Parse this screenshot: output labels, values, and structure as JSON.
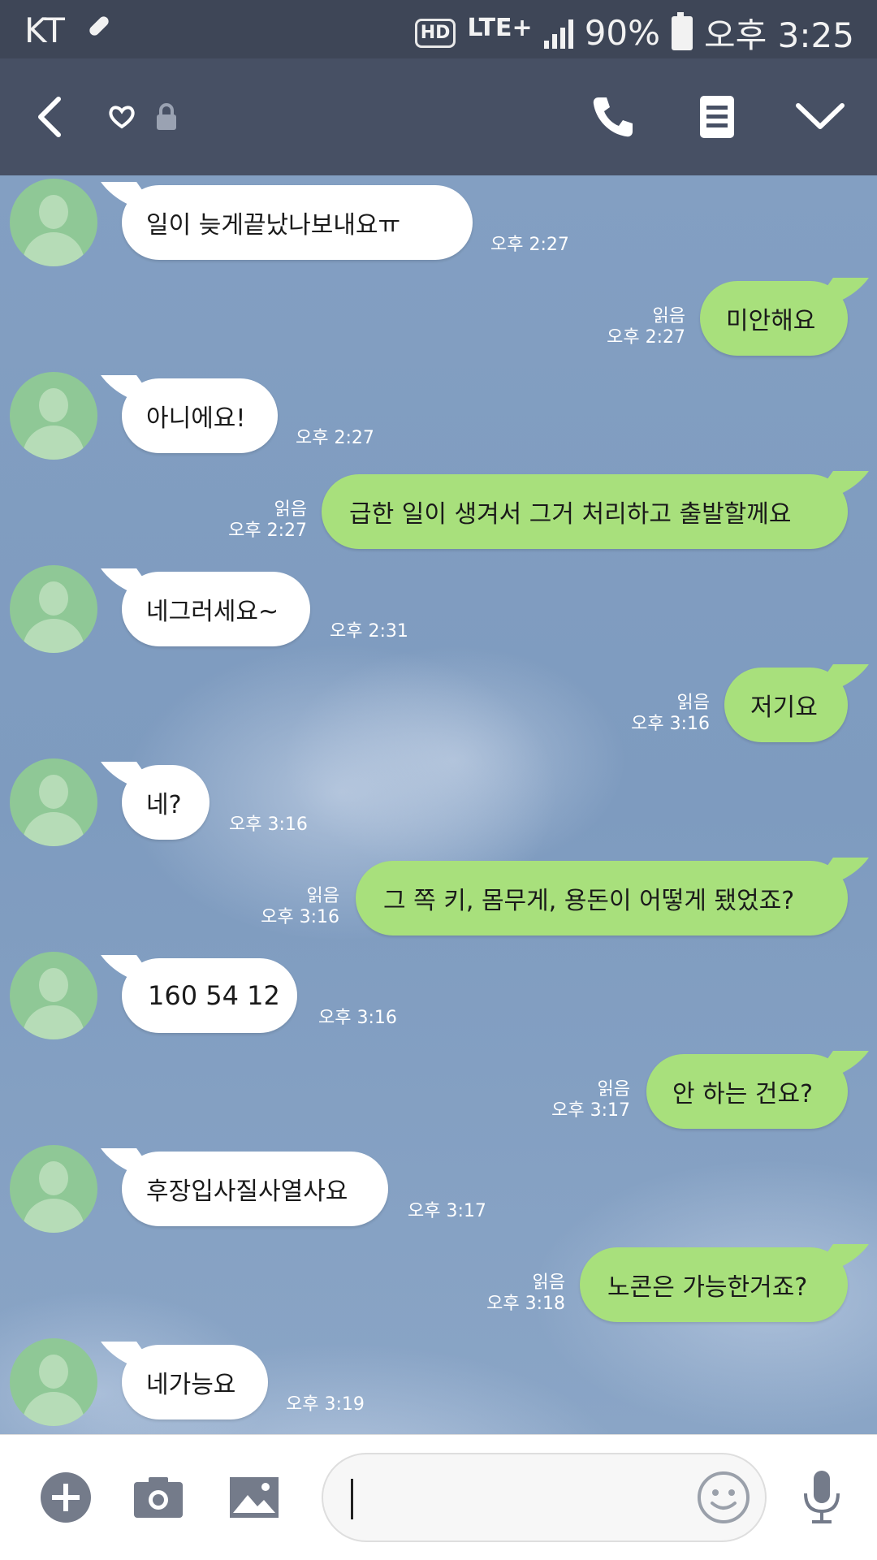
{
  "status_bar": {
    "carrier": "KT",
    "hd": "HD",
    "network": "LTE+",
    "battery": "90%",
    "time": "오후 3:25"
  },
  "header": {
    "icons": [
      "back-icon",
      "heart-icon",
      "lock-icon",
      "phone-icon",
      "menu-icon",
      "chevron-down-icon"
    ]
  },
  "messages": [
    {
      "side": "in",
      "text": "일이 늦게끝났나보내요ㅠ",
      "time": "오후 2:27"
    },
    {
      "side": "out",
      "text": "미안해요",
      "read": "읽음",
      "time": "오후 2:27"
    },
    {
      "side": "in",
      "text": "아니에요!",
      "time": "오후 2:27"
    },
    {
      "side": "out",
      "text": "급한 일이 생겨서 그거 처리하고 출발할께요",
      "read": "읽음",
      "time": "오후 2:27"
    },
    {
      "side": "in",
      "text": "네그러세요~",
      "time": "오후 2:31"
    },
    {
      "side": "out",
      "text": "저기요",
      "read": "읽음",
      "time": "오후 3:16"
    },
    {
      "side": "in",
      "text": "네?",
      "time": "오후 3:16"
    },
    {
      "side": "out",
      "text": "그 쪽 키, 몸무게, 용돈이 어떻게 됐었죠?",
      "read": "읽음",
      "time": "오후 3:16"
    },
    {
      "side": "in",
      "text": "160 54 12",
      "time": "오후 3:16"
    },
    {
      "side": "out",
      "text": "안 하는 건요?",
      "read": "읽음",
      "time": "오후 3:17"
    },
    {
      "side": "in",
      "text": "후장입사질사열사요",
      "time": "오후 3:17"
    },
    {
      "side": "out",
      "text": "노콘은 가능한거죠?",
      "read": "읽음",
      "time": "오후 3:18"
    },
    {
      "side": "in",
      "text": "네가능요",
      "time": "오후 3:19"
    }
  ],
  "input_bar": {
    "message_value": "",
    "icons": [
      "plus-icon",
      "camera-icon",
      "image-icon",
      "emoji-icon",
      "mic-icon"
    ]
  },
  "colors": {
    "status_bar_bg": "#3e4657",
    "header_bg": "#475064",
    "incoming_bubble": "#ffffff",
    "outgoing_bubble": "#a8e07c",
    "chat_bg": "#7f9cc0"
  }
}
